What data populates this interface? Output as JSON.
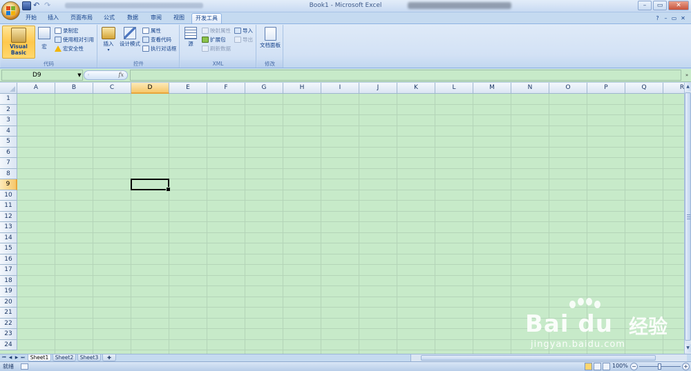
{
  "window": {
    "title": "Book1 - Microsoft Excel",
    "controls": [
      "?",
      "–",
      "▭",
      "✕"
    ]
  },
  "tabs": [
    {
      "label": "开始"
    },
    {
      "label": "插入"
    },
    {
      "label": "页面布局"
    },
    {
      "label": "公式"
    },
    {
      "label": "数据"
    },
    {
      "label": "审阅"
    },
    {
      "label": "视图"
    },
    {
      "label": "开发工具",
      "active": true
    }
  ],
  "ribbon": {
    "code_group": {
      "label": "代码",
      "visual_basic": "Visual Basic",
      "macro": "宏",
      "record_macro": "录制宏",
      "relative_ref": "使用相对引用",
      "macro_security": "宏安全性"
    },
    "controls_group": {
      "label": "控件",
      "insert": "插入",
      "design_mode": "设计模式",
      "properties": "属性",
      "view_code": "查看代码",
      "run_dialog": "执行对话框"
    },
    "xml_group": {
      "label": "XML",
      "source": "源",
      "map_properties": "映射属性",
      "expansion_packs": "扩展包",
      "refresh_data": "刷新数据",
      "import": "导入",
      "export": "导出"
    },
    "modify_group": {
      "label": "修改",
      "document_panel": "文档面板"
    }
  },
  "formula_bar": {
    "name_box": "D9",
    "fx": "fx",
    "formula": ""
  },
  "grid": {
    "columns": [
      "A",
      "B",
      "C",
      "D",
      "E",
      "F",
      "G",
      "H",
      "I",
      "J",
      "K",
      "L",
      "M",
      "N",
      "O",
      "P",
      "Q",
      "R"
    ],
    "rows": [
      "1",
      "2",
      "3",
      "4",
      "5",
      "6",
      "7",
      "8",
      "9",
      "10",
      "11",
      "12",
      "13",
      "14",
      "15",
      "16",
      "17",
      "18",
      "19",
      "20",
      "21",
      "22",
      "23",
      "24"
    ],
    "selected_column": "D",
    "selected_row": "9"
  },
  "sheets": [
    {
      "label": "Sheet1",
      "active": true
    },
    {
      "label": "Sheet2"
    },
    {
      "label": "Sheet3"
    }
  ],
  "status": {
    "ready": "就绪",
    "zoom": "100%"
  },
  "watermark": {
    "brand": "Bai du",
    "cn": "经验",
    "url": "jingyan.baidu.com"
  },
  "colors": {
    "sheet_bg": "#c7eac9",
    "ribbon_blue": "#c5daf0",
    "selected_header": "#f6c76a"
  }
}
